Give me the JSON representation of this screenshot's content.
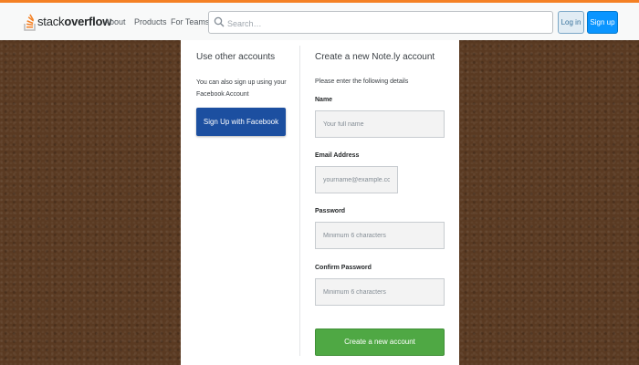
{
  "header": {
    "logo_text_plain": "stack",
    "logo_text_bold": "overflow",
    "nav": [
      "About",
      "Products",
      "For Teams"
    ],
    "search_placeholder": "Search…",
    "login_label": "Log in",
    "signup_label": "Sign up",
    "accent_color": "#f48024"
  },
  "left_column": {
    "title": "Use other accounts",
    "text": "You can also sign up using your Facebook Account",
    "facebook_button": "Sign Up with Facebook"
  },
  "right_column": {
    "title": "Create a new Note.ly account",
    "subtitle": "Please enter the following details",
    "fields": [
      {
        "label": "Name",
        "placeholder": "Your full name",
        "value": ""
      },
      {
        "label": "Email Address",
        "placeholder": "yourname@example.com",
        "value": ""
      },
      {
        "label": "Password",
        "placeholder": "Minimum 6 characters",
        "value": ""
      },
      {
        "label": "Confirm Password",
        "placeholder": "Minimum 6 characters",
        "value": ""
      }
    ],
    "submit_label": "Create a new account"
  },
  "colors": {
    "facebook_button": "#1c4fa0",
    "submit_button": "#4fa844",
    "signup_button": "#0a95ff"
  }
}
